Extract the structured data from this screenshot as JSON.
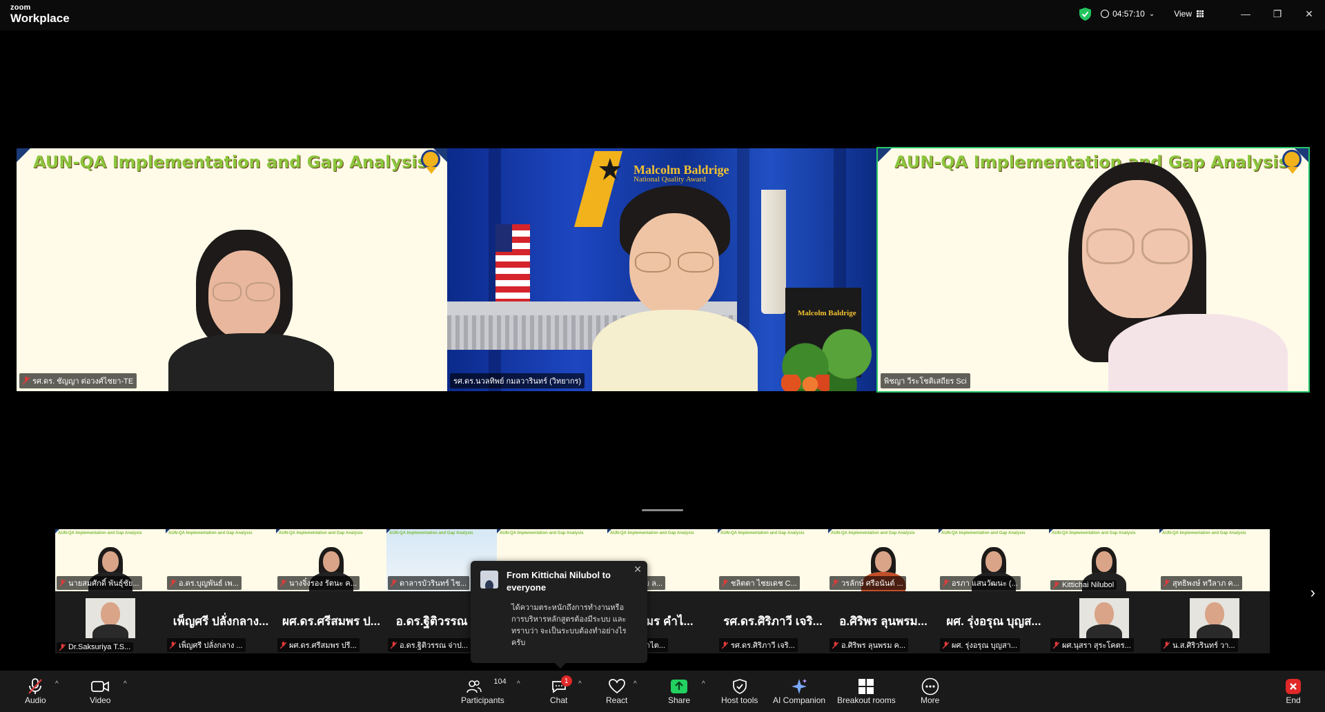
{
  "app": {
    "brand_top": "zoom",
    "brand_bottom": "Workplace"
  },
  "titlebar": {
    "timer": "04:57:10",
    "view_label": "View"
  },
  "speakers": [
    {
      "banner": "AUN-QA Implementation and Gap Analysis",
      "name": "รศ.ดร. ชัญญา ต่อวงศ์ไชยา-TE",
      "muted": true
    },
    {
      "banner": "",
      "logo_text": "Malcolm Baldrige",
      "logo_sub": "National Quality Award",
      "podium_text": "Malcolm Baldrige",
      "name": "รศ.ดร.นวลทิพย์ กมลวารินทร์ (วิทยากร)",
      "muted": false
    },
    {
      "banner": "AUN-QA Implementation and Gap Analysis",
      "name": "พิชญา วีระโชติเสถียร Sci",
      "muted": false,
      "active": true
    }
  ],
  "gallery": {
    "mini_banner": "AUN-QA Implementation and Gap Analysis",
    "top_row": [
      {
        "name": "นายสมศักดิ์ พันธุ์ชัย...",
        "type": "slide",
        "has_person": true
      },
      {
        "name": "อ.ดร.บุญพันธ์ เพ...",
        "type": "slide",
        "has_person": false
      },
      {
        "name": "นางจิ๋งรอง รัตนะ ค...",
        "type": "slide",
        "has_person": true
      },
      {
        "name": "ดาลารบัวรินทร์ ไช...",
        "type": "slide",
        "has_person": false
      },
      {
        "name": "",
        "type": "slide",
        "has_person": false
      },
      {
        "name": "วรรณชัย ล...",
        "type": "slide",
        "has_person": false
      },
      {
        "name": "ชลิตตา ไชยเดช C...",
        "type": "slide",
        "has_person": false
      },
      {
        "name": "วรลักษ์ ศรีอนันต์ ...",
        "type": "slide",
        "has_person": true
      },
      {
        "name": "อรภา แสนวัฒนะ (...",
        "type": "slide",
        "has_person": true
      },
      {
        "name": "Kittichai Nilubol",
        "type": "slide",
        "has_person": true
      },
      {
        "name": "สุทธิพงษ์ ทวีลาภ ค...",
        "type": "slide",
        "has_person": false
      }
    ],
    "bottom_row": [
      {
        "name": "Dr.Saksuriya T.S...",
        "big": "",
        "photo": true
      },
      {
        "name": "เพ็ญศรี ปลั่งกลาง ...",
        "big": "เพ็ญศรี ปลั่งกลาง...",
        "photo": false
      },
      {
        "name": "ผศ.ดร.ศรีสมพร ปรี...",
        "big": "ผศ.ดร.ศรีสมพร ป...",
        "photo": false
      },
      {
        "name": "อ.ดร.ฐิติวรรณ จ่าป...",
        "big": "อ.ดร.ฐิติวรรณ จ่...",
        "photo": false
      },
      {
        "name": "",
        "big": "",
        "photo": false
      },
      {
        "name": "ตามร คำไต...",
        "big": "ตามร คำไ...",
        "photo": false
      },
      {
        "name": "รศ.ดร.ศิริภาวี เจริ...",
        "big": "รศ.ดร.ศิริภาวี เจริ...",
        "photo": false
      },
      {
        "name": "อ.ศิริพร ลุนพรม ค...",
        "big": "อ.ศิริพร ลุนพรม...",
        "photo": false
      },
      {
        "name": "ผศ. รุ่งอรุณ บุญสา...",
        "big": "ผศ. รุ่งอรุณ บุญส...",
        "photo": false
      },
      {
        "name": "ผศ.นุสรา สุระโคตร...",
        "big": "",
        "photo": true
      },
      {
        "name": "น.ส.ศิริวรินทร์ วา...",
        "big": "",
        "photo": true
      }
    ]
  },
  "chat_popup": {
    "from": "From Kittichai Nilubol to everyone",
    "message": "ได้ความตระหนักถึงการทำงานหรือการบริหารหลักสูตรต้องมีระบบ และทราบว่า จะเป็นระบบต้องทำอย่างไรครับ"
  },
  "toolbar": {
    "audio": "Audio",
    "video": "Video",
    "participants": "Participants",
    "participants_count": "104",
    "chat": "Chat",
    "chat_badge": "1",
    "react": "React",
    "share": "Share",
    "host_tools": "Host tools",
    "ai_companion": "AI Companion",
    "breakout_rooms": "Breakout rooms",
    "more": "More",
    "end": "End"
  },
  "colors": {
    "accent_green": "#27c76b",
    "banner_green": "#8cc63e",
    "end_red": "#e02828",
    "share_green": "#23d160"
  }
}
